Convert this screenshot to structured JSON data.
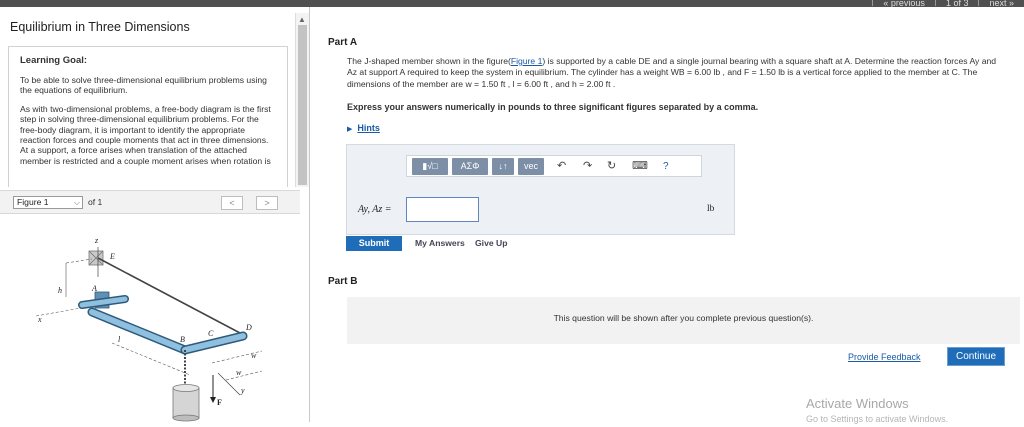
{
  "topnav": [
    "« previous",
    "1 of 3",
    "next »"
  ],
  "left": {
    "title": "Equilibrium in Three Dimensions",
    "goal_heading": "Learning Goal:",
    "goal_text": "To be able to solve three-dimensional equilibrium problems using the equations of equilibrium.",
    "body_text": "As with two-dimensional problems, a free-body diagram is the first step in solving three-dimensional equilibrium problems. For the free-body diagram, it is important to identify the appropriate reaction forces and couple moments that act in three dimensions. At a support, a force arises when translation of the attached member is restricted and a couple moment arises when rotation is",
    "figure_select": "Figure 1",
    "figure_of": "of 1",
    "prev_glyph": "<",
    "next_glyph": ">",
    "figure_labels": {
      "z": "z",
      "E": "E",
      "h": "h",
      "A": "A",
      "x": "x",
      "l": "l",
      "B": "B",
      "C": "C",
      "D": "D",
      "w1": "w",
      "w2": "w",
      "y": "y",
      "F": "F"
    }
  },
  "partA": {
    "label": "Part A",
    "problem_pre": "The J-shaped member shown in the figure(",
    "figure_link": "Figure 1",
    "problem_post": ") is supported by a cable DE and a single journal bearing with a square shaft at A. Determine the reaction forces Ay and Az at support A required to keep the system in equilibrium. The cylinder has a weight WB = 6.00 lb , and F = 1.50 lb is a vertical force applied to the member at C. The dimensions of the member are w = 1.50 ft , l = 6.00 ft , and h = 2.00 ft .",
    "instruction": "Express your answers numerically in pounds to three significant figures separated by a comma.",
    "hints_label": "Hints",
    "toolbar": {
      "templates": "▮√□",
      "greek": "ΑΣΦ",
      "arrows": "↓↑",
      "vec": "vec",
      "undo": "↶",
      "redo": "↷",
      "reset": "↻",
      "keyboard": "⌨",
      "help": "?"
    },
    "equation_label": "Ay, Az =",
    "input_value": "",
    "unit": "lb",
    "submit": "Submit",
    "my_answers": "My Answers",
    "give_up": "Give Up"
  },
  "partB": {
    "label": "Part B",
    "message": "This question will be shown after you complete previous question(s)."
  },
  "footer": {
    "feedback": "Provide Feedback",
    "continue": "Continue"
  },
  "watermark": {
    "title": "Activate Windows",
    "subtitle": "Go to Settings to activate Windows."
  }
}
